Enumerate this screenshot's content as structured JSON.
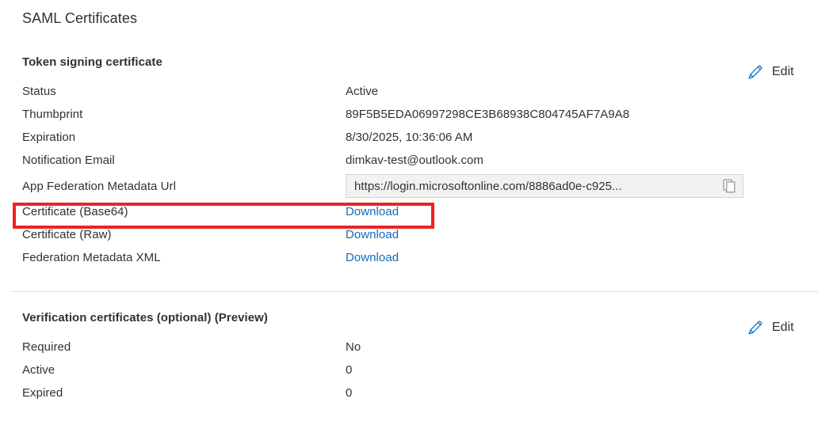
{
  "page": {
    "title": "SAML Certificates"
  },
  "token_signing": {
    "heading": "Token signing certificate",
    "edit_label": "Edit",
    "edit_icon": "pencil-icon",
    "rows": [
      {
        "label": "Status",
        "value": "Active",
        "type": "text"
      },
      {
        "label": "Thumbprint",
        "value": "89F5B5EDA06997298CE3B68938C804745AF7A9A8",
        "type": "text"
      },
      {
        "label": "Expiration",
        "value": "8/30/2025, 10:36:06 AM",
        "type": "text"
      },
      {
        "label": "Notification Email",
        "value": "dimkav-test@outlook.com",
        "type": "text"
      },
      {
        "label": "App Federation Metadata Url",
        "value": "https://login.microsoftonline.com/8886ad0e-c925...",
        "type": "url-field",
        "copy_icon": "copy-icon"
      },
      {
        "label": "Certificate (Base64)",
        "value": "Download",
        "type": "link",
        "highlighted": true
      },
      {
        "label": "Certificate (Raw)",
        "value": "Download",
        "type": "link"
      },
      {
        "label": "Federation Metadata XML",
        "value": "Download",
        "type": "link"
      }
    ]
  },
  "verification_certificates": {
    "heading": "Verification certificates (optional) (Preview)",
    "edit_label": "Edit",
    "edit_icon": "pencil-icon",
    "rows": [
      {
        "label": "Required",
        "value": "No",
        "type": "text"
      },
      {
        "label": "Active",
        "value": "0",
        "type": "text"
      },
      {
        "label": "Expired",
        "value": "0",
        "type": "text"
      }
    ]
  },
  "annotation": {
    "highlight_color": "#ee2222",
    "target": "Certificate (Base64)"
  },
  "colors": {
    "link": "#0f6cbd",
    "accent": "#0f6cbd",
    "text": "#323130",
    "field_bg": "#f3f2f1",
    "divider": "#e1dfdd"
  }
}
